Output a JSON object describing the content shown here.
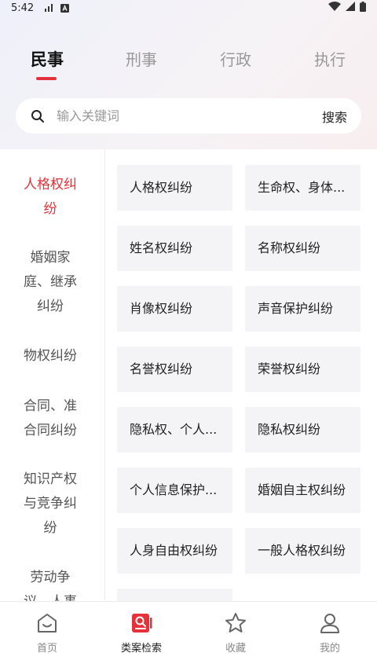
{
  "status_bar": {
    "time": "5:42"
  },
  "tabs": [
    {
      "label": "民事",
      "active": true
    },
    {
      "label": "刑事",
      "active": false
    },
    {
      "label": "行政",
      "active": false
    },
    {
      "label": "执行",
      "active": false
    }
  ],
  "search": {
    "placeholder": "输入关键词",
    "button_label": "搜索"
  },
  "sidebar": {
    "items": [
      {
        "label": "人格权纠纷",
        "active": true
      },
      {
        "label": "婚姻家庭、继承纠纷",
        "active": false
      },
      {
        "label": "物权纠纷",
        "active": false
      },
      {
        "label": "合同、准合同纠纷",
        "active": false
      },
      {
        "label": "知识产权与竞争纠纷",
        "active": false
      },
      {
        "label": "劳动争议、人事",
        "active": false
      }
    ]
  },
  "grid": {
    "cells": [
      "人格权纠纷",
      "生命权、身体...",
      "姓名权纠纷",
      "名称权纠纷",
      "肖像权纠纷",
      "声音保护纠纷",
      "名誉权纠纷",
      "荣誉权纠纷",
      "隐私权、个人...",
      "隐私权纠纷",
      "个人信息保护...",
      "婚姻自主权纠纷",
      "人身自由权纠纷",
      "一般人格权纠纷",
      ""
    ]
  },
  "bottom_nav": [
    {
      "label": "首页",
      "icon": "home-icon",
      "active": false
    },
    {
      "label": "类案检索",
      "icon": "case-search-icon",
      "active": true
    },
    {
      "label": "收藏",
      "icon": "star-icon",
      "active": false
    },
    {
      "label": "我的",
      "icon": "user-icon",
      "active": false
    }
  ],
  "colors": {
    "accent": "#e5323a",
    "cell_bg": "#f4f4f6"
  }
}
